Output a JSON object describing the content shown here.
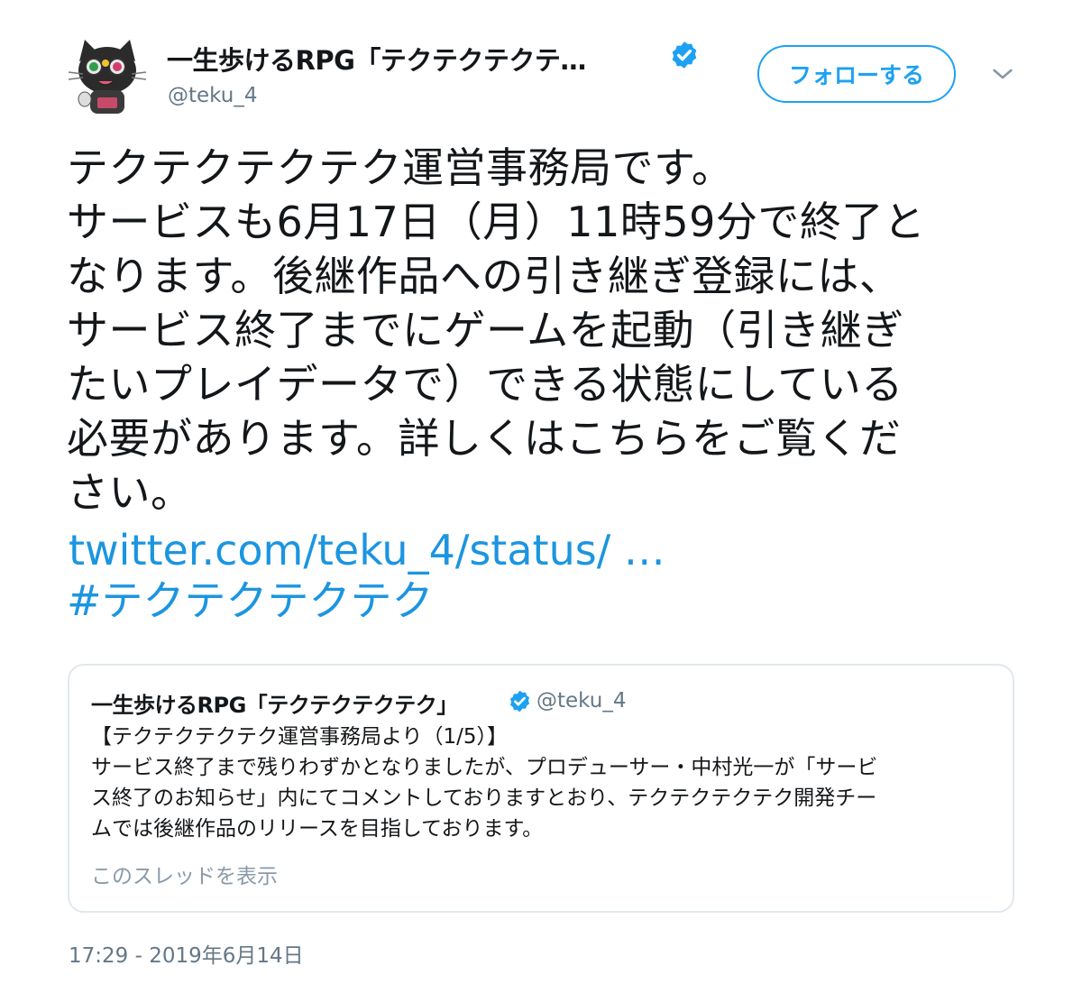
{
  "author": {
    "display_name": "一生歩けるRPG「テクテクテクテ…",
    "handle": "@teku_4",
    "avatar_icon": "black-cat-mascot-avatar",
    "verified_icon": "verified-badge-icon"
  },
  "actions": {
    "follow_label": "フォローする",
    "menu_icon": "chevron-down-icon"
  },
  "tweet": {
    "lines": [
      "テクテクテクテク運営事務局です。",
      "サービスも6月17日（月）11時59分で終了と",
      "なります。後継作品への引き継ぎ登録には、",
      "サービス終了までにゲームを起動（引き継ぎ",
      "たいプレイデータで）できる状態にしている",
      "必要があります。詳しくはこちらをご覧くだ",
      "さい。"
    ],
    "link": "twitter.com/teku_4/status/ …",
    "hashtag": "#テクテクテクテク"
  },
  "quote": {
    "display_name": "一生歩けるRPG「テクテクテクテク」",
    "handle": "@teku_4",
    "lines": [
      "【テクテクテクテク運営事務局より（1/5）】",
      "サービス終了まで残りわずかとなりましたが、プロデューサー・中村光一が「サービ",
      "ス終了のお知らせ」内にてコメントしておりますとおり、テクテクテクテク開発チー",
      "ムでは後継作品のリリースを目指しております。"
    ],
    "show_thread": "このスレッドを表示"
  },
  "timestamp": "17:29 - 2019年6月14日",
  "colors": {
    "accent": "#1da1f2",
    "link": "#1b95e0",
    "muted": "#657786",
    "border": "#e1e8ed",
    "text": "#14171a"
  }
}
